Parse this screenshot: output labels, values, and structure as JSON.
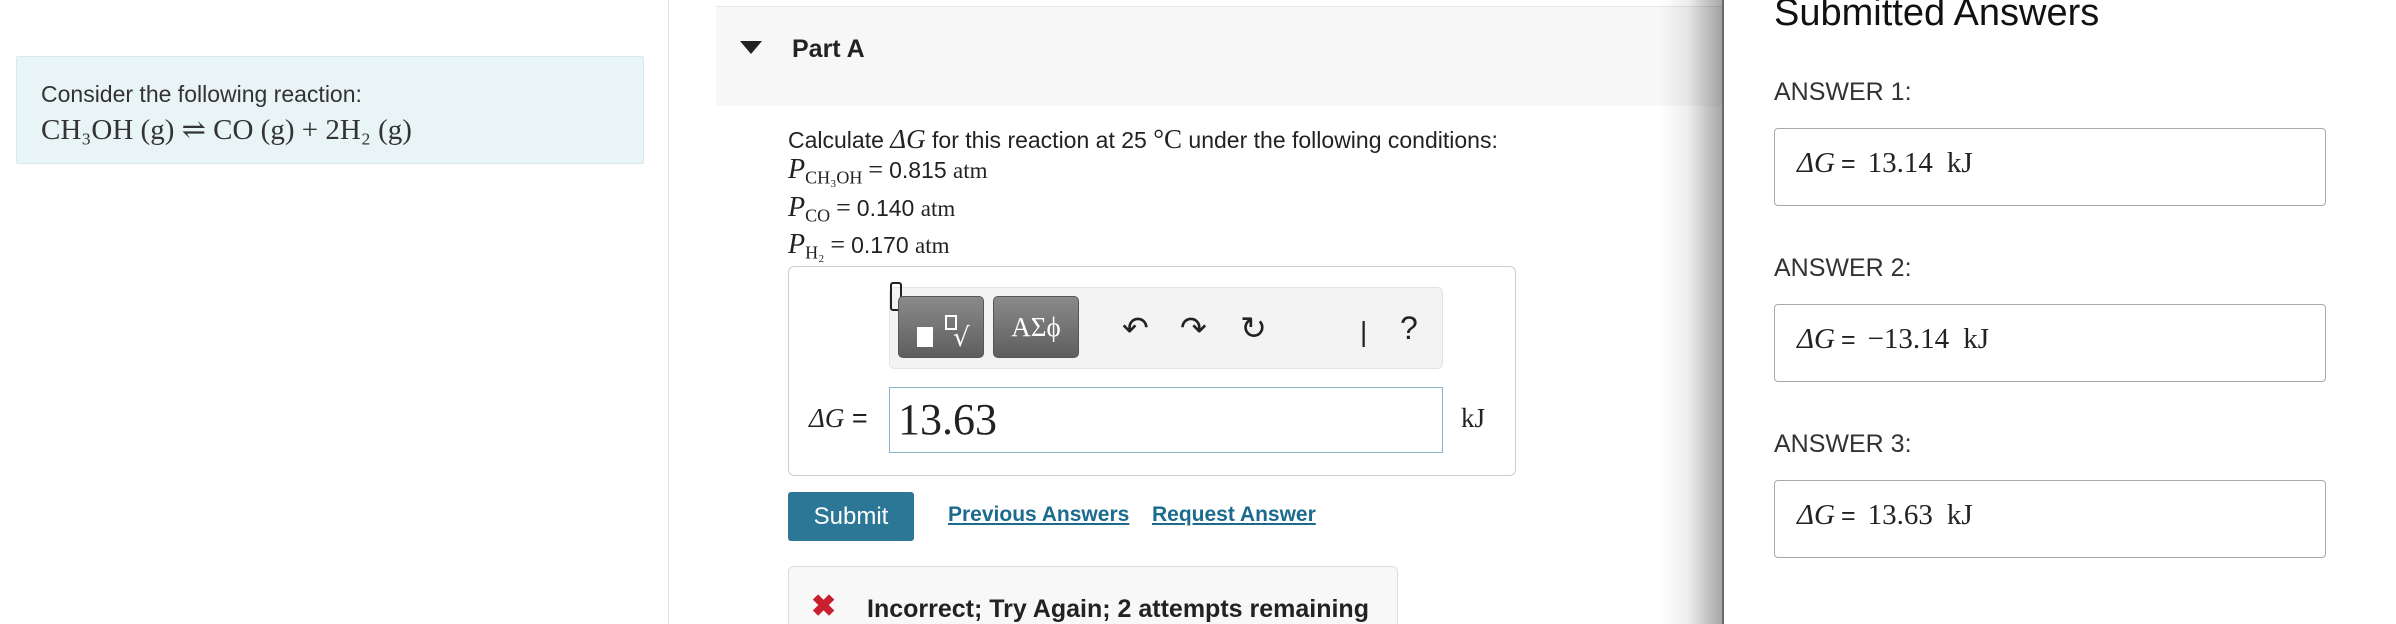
{
  "context": {
    "intro": "Consider the following reaction:",
    "equation": "CH₃OH (g) ⇌ CO (g) + 2H₂ (g)"
  },
  "part": {
    "title": "Part A"
  },
  "question": {
    "prefix": "Calculate",
    "symbol": "ΔG",
    "middle": "for this reaction at 25",
    "temp_unit": "°C",
    "suffix": "under the following conditions:",
    "conditions": [
      {
        "var": "P",
        "sub": "CH₃OH",
        "value": "0.815",
        "unit": "atm"
      },
      {
        "var": "P",
        "sub": "CO",
        "value": "0.140",
        "unit": "atm"
      },
      {
        "var": "P",
        "sub": "H₂",
        "value": "0.170",
        "unit": "atm"
      }
    ]
  },
  "toolbar": {
    "greek_label": "ΑΣϕ",
    "undo_icon": "↶",
    "redo_icon": "↷",
    "reset_icon": "↻",
    "bar_glyph": "|",
    "help_label": "?"
  },
  "answer": {
    "label_symbol": "ΔG",
    "label_eq": "=",
    "value": "13.63",
    "unit": "kJ"
  },
  "actions": {
    "submit_label": "Submit",
    "previous_label": "Previous Answers",
    "request_label": "Request Answer"
  },
  "feedback": {
    "icon": "✖",
    "text": "Incorrect; Try Again; 2 attempts remaining"
  },
  "submitted": {
    "title": "Submitted Answers",
    "answers": [
      {
        "label": "ANSWER 1:",
        "symbol": "ΔG",
        "eq": "=",
        "value": "13.14",
        "unit": "kJ"
      },
      {
        "label": "ANSWER 2:",
        "symbol": "ΔG",
        "eq": "=",
        "value": "−13.14",
        "unit": "kJ"
      },
      {
        "label": "ANSWER 3:",
        "symbol": "ΔG",
        "eq": "=",
        "value": "13.63",
        "unit": "kJ"
      }
    ]
  }
}
